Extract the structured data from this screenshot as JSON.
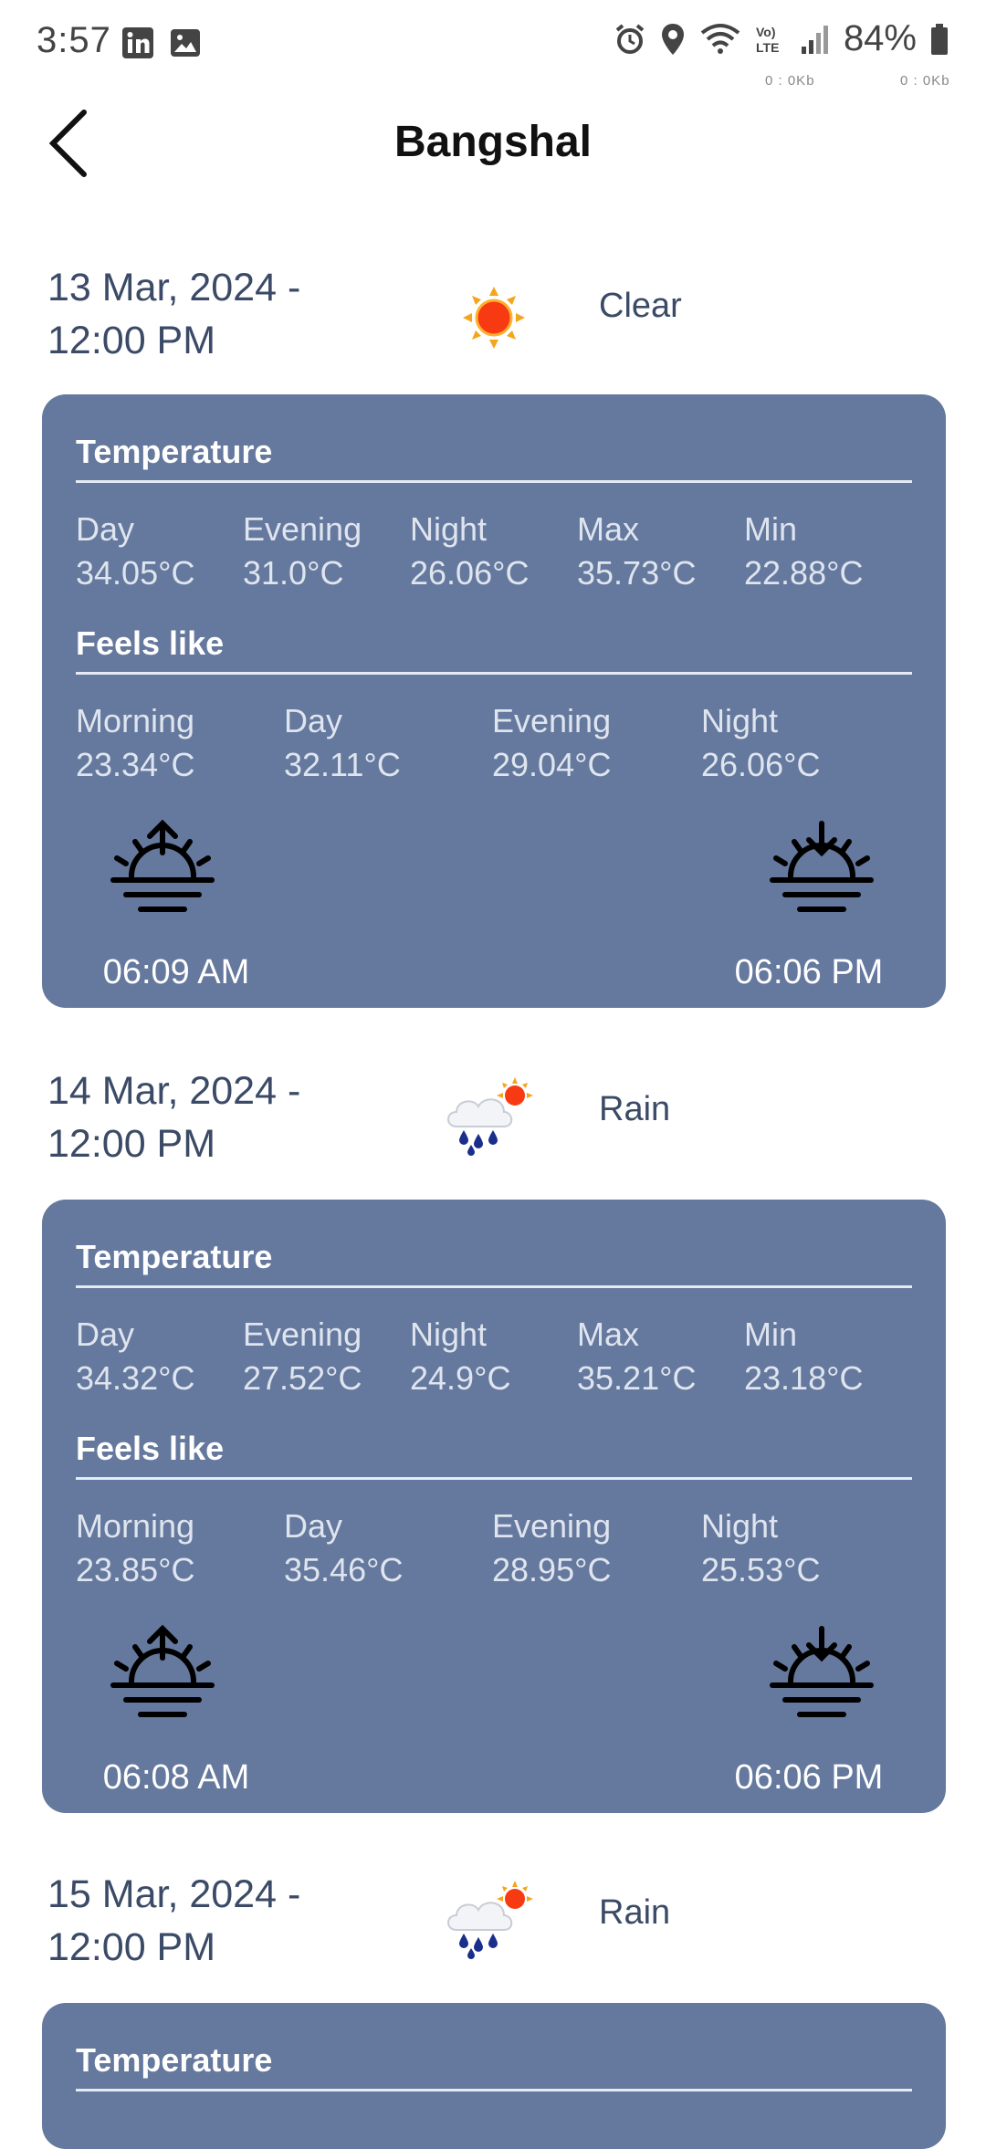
{
  "status_bar": {
    "time": "3:57",
    "battery": "84%",
    "net_down": "0 : 0Kb",
    "net_up": "0 : 0Kb"
  },
  "app_bar": {
    "title": "Bangshal"
  },
  "labels": {
    "temperature": "Temperature",
    "feels_like": "Feels like",
    "day": "Day",
    "evening": "Evening",
    "night": "Night",
    "max": "Max",
    "min": "Min",
    "morning": "Morning"
  },
  "days": [
    {
      "date_line1": "13 Mar, 2024 -",
      "date_line2": "12:00 PM",
      "condition": "Clear",
      "icon": "sun-icon",
      "temp": {
        "day": "34.05°C",
        "evening": "31.0°C",
        "night": "26.06°C",
        "max": "35.73°C",
        "min": "22.88°C"
      },
      "feels": {
        "morning": "23.34°C",
        "day": "32.11°C",
        "evening": "29.04°C",
        "night": "26.06°C"
      },
      "sunrise": "06:09 AM",
      "sunset": "06:06 PM"
    },
    {
      "date_line1": "14 Mar, 2024 -",
      "date_line2": "12:00 PM",
      "condition": "Rain",
      "icon": "rain-cloud-icon",
      "temp": {
        "day": "34.32°C",
        "evening": "27.52°C",
        "night": "24.9°C",
        "max": "35.21°C",
        "min": "23.18°C"
      },
      "feels": {
        "morning": "23.85°C",
        "day": "35.46°C",
        "evening": "28.95°C",
        "night": "25.53°C"
      },
      "sunrise": "06:08 AM",
      "sunset": "06:06 PM"
    },
    {
      "date_line1": "15 Mar, 2024 -",
      "date_line2": "12:00 PM",
      "condition": "Rain",
      "icon": "rain-cloud-icon"
    }
  ]
}
